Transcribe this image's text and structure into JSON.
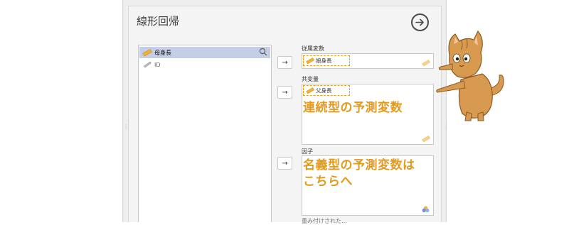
{
  "dialog": {
    "title": "線形回帰"
  },
  "variables": {
    "items": [
      {
        "label": "母身長",
        "type": "scale",
        "selected": true
      },
      {
        "label": "ID",
        "type": "id",
        "selected": false
      }
    ]
  },
  "targets": {
    "dependent": {
      "label": "従属変数",
      "chip": "娘身長"
    },
    "covariates": {
      "label": "共変量",
      "chip": "父身長"
    },
    "factors": {
      "label": "因子"
    },
    "next_label": "重み付けされた…"
  },
  "annotations": {
    "covariates_note": "連続型の予測変数",
    "factors_note_line1": "名義型の予測変数は",
    "factors_note_line2": "こちらへ"
  },
  "buttons": {
    "arrow": "→"
  },
  "icons": {
    "run": "run-arrow-icon",
    "search": "search-icon",
    "scale": "ruler-icon",
    "id": "id-pencil-icon",
    "nominal": "circles-icon"
  },
  "colors": {
    "accent": "#e39a1c",
    "selected_row": "#c4cfe6",
    "panel": "#eeeeee"
  }
}
